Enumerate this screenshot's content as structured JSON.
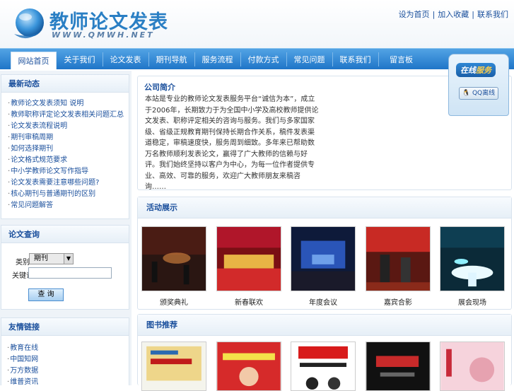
{
  "site": {
    "title": "教师论文发表",
    "subtitle": "WWW.QMWH.NET"
  },
  "toplinks": [
    "设为首页",
    "加入收藏",
    "联系我们"
  ],
  "nav": [
    "网站首页",
    "关于我们",
    "论文发表",
    "期刊导航",
    "服务流程",
    "付款方式",
    "常见问题",
    "联系我们",
    "留言板"
  ],
  "panels": {
    "news_title": "最新动态",
    "search_title": "论文查询",
    "links_title": "友情链接",
    "intro_title": "公司简介",
    "gallery_title": "活动展示",
    "books_title": "图书推荐"
  },
  "news": [
    "教师论文发表须知 说明",
    "教师职称评定论文发表相关问题汇总",
    "论文发表流程说明",
    "期刊审稿周期",
    "如何选择期刊",
    "论文格式规范要求",
    "中小学教师论文写作指导",
    "论文发表需要注意哪些问题?",
    "核心期刊与普通期刊的区别",
    "常见问题解答"
  ],
  "search": {
    "type_label": "类别",
    "type_value": "期刊",
    "keyword_label": "关键词",
    "keyword_value": "",
    "button": "查 询"
  },
  "links": [
    "教育在线",
    "中国知网",
    "万方数据",
    "维普资讯"
  ],
  "intro": {
    "text": "本站是专业的教师论文发表服务平台“诚信为本”，成立于2006年，长期致力于为全国中小学及高校教师提供论文发表、职称评定相关的咨询与服务。我们与多家国家级、省级正规教育期刊保持长期合作关系，稿件发表渠道稳定，审稿速度快，服务周到细致。多年来已帮助数万名教师顺利发表论文，赢得了广大教师的信赖与好评。我们始终坚持以客户为中心，为每一位作者提供专业、高效、可靠的服务，欢迎广大教师朋友来稿咨询……"
  },
  "gallery": [
    "颁奖典礼",
    "新春联欢",
    "年度会议",
    "嘉宾合影",
    "展会现场"
  ],
  "service": {
    "title_a": "在线",
    "title_b": "服务",
    "qq": "QQ离线"
  },
  "colors": {
    "nav_top": "#52a3e4",
    "nav_bottom": "#1f75c8",
    "link": "#1a4f9c",
    "logo": "#2a7fc4"
  }
}
